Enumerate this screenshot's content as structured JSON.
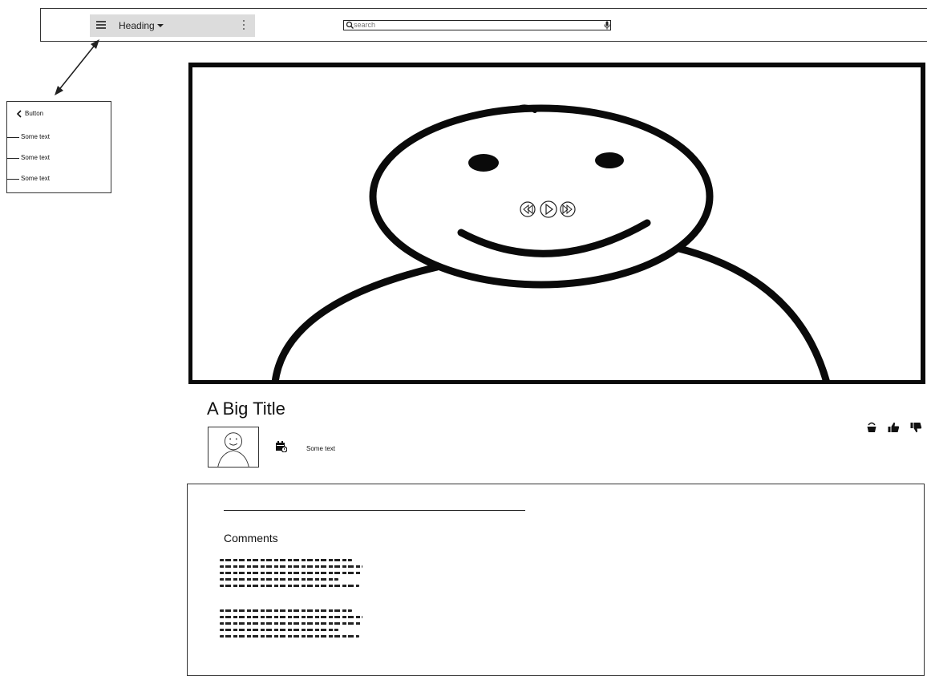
{
  "header": {
    "heading": "Heading",
    "search": {
      "value": "",
      "placeholder": "search"
    }
  },
  "side_menu": {
    "back_label": "Button",
    "items": [
      {
        "label": "Some text"
      },
      {
        "label": "Some text"
      },
      {
        "label": "Some text"
      }
    ]
  },
  "video": {
    "controls": [
      "rewind-icon",
      "play-icon",
      "fast-forward-icon"
    ]
  },
  "title": "A Big Title",
  "meta_text": "Some text",
  "actions": [
    "bucket-icon",
    "thumbs-up-icon",
    "thumbs-down-icon"
  ],
  "comments": {
    "heading": "Comments"
  },
  "colors": {
    "menu_background": "#dcdcdc",
    "ink": "#111111"
  }
}
